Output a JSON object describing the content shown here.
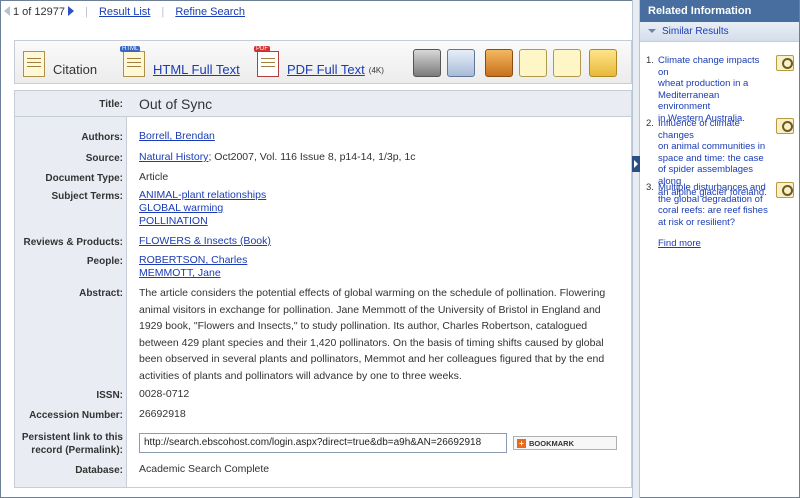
{
  "nav": {
    "record_position": "1 of 12977",
    "result_list": "Result List",
    "refine_search": "Refine Search"
  },
  "toolbar": {
    "citation": "Citation",
    "html_badge": "HTML",
    "html_full_text": "HTML Full Text",
    "pdf_badge": "PDF",
    "pdf_full_text": "PDF Full Text",
    "pdf_size": "(4K)",
    "tool_icons": [
      "printer-icon",
      "email-icon",
      "save-icon",
      "cite-icon",
      "export-icon",
      "folder-icon"
    ]
  },
  "record": {
    "title_label": "Title:",
    "title": "Out of Sync",
    "authors_label": "Authors:",
    "authors": "Borrell, Brendan",
    "source_label": "Source:",
    "source_link": "Natural History",
    "source_rest": "; Oct2007, Vol. 116 Issue 8, p14-14, 1/3p, 1c",
    "doctype_label": "Document Type:",
    "doctype": "Article",
    "subject_label": "Subject Terms:",
    "subjects": [
      "ANIMAL-plant relationships",
      "GLOBAL warming",
      "POLLINATION"
    ],
    "reviews_label": "Reviews & Products:",
    "reviews": "FLOWERS & Insects (Book)",
    "people_label": "People:",
    "people": [
      "ROBERTSON, Charles",
      "MEMMOTT, Jane"
    ],
    "abstract_label": "Abstract:",
    "abstract_lines": [
      "The article considers the potential effects of global warming on the schedule of pollination. Flowering",
      "animal visitors in exchange for pollination. Jane Memmott of the University of Bristol in England and",
      "1929 book, \"Flowers and Insects,\" to study pollination. Its author, Charles Robertson, catalogued",
      "between 429 plant species and their 1,420 pollinators. On the basis of timing shifts caused by global",
      "been observed in several plants and pollinators, Memmot and her colleagues figured that by the end",
      "activities of plants and pollinators will advance by one to three weeks."
    ],
    "issn_label": "ISSN:",
    "issn": "0028-0712",
    "accession_label": "Accession Number:",
    "accession": "26692918",
    "permalink_label_1": "Persistent link to this",
    "permalink_label_2": "record (Permalink):",
    "permalink": "http://search.ebscohost.com/login.aspx?direct=true&db=a9h&AN=26692918",
    "bookmark": "BOOKMARK",
    "database_label": "Database:",
    "database": "Academic Search Complete"
  },
  "related": {
    "header": "Related Information",
    "section": "Similar Results",
    "items": [
      {
        "num": "1.",
        "lines": [
          "Climate change impacts on",
          "wheat production in a",
          "Mediterranean environment",
          "in Western Australia."
        ]
      },
      {
        "num": "2.",
        "lines": [
          "Influence of climate changes",
          "on animal communities in",
          "space and time: the case",
          "of spider assemblages along",
          "an alpine glacier foreland."
        ]
      },
      {
        "num": "3.",
        "lines": [
          "Multiple disturbances and",
          "the global degradation of",
          "coral reefs: are reef fishes",
          "at risk or resilient?"
        ]
      }
    ],
    "find_more": "Find more"
  },
  "colors": {
    "link": "#1a3cb5",
    "panel_header": "#476e9e",
    "label_bg": "#e9edf3"
  }
}
